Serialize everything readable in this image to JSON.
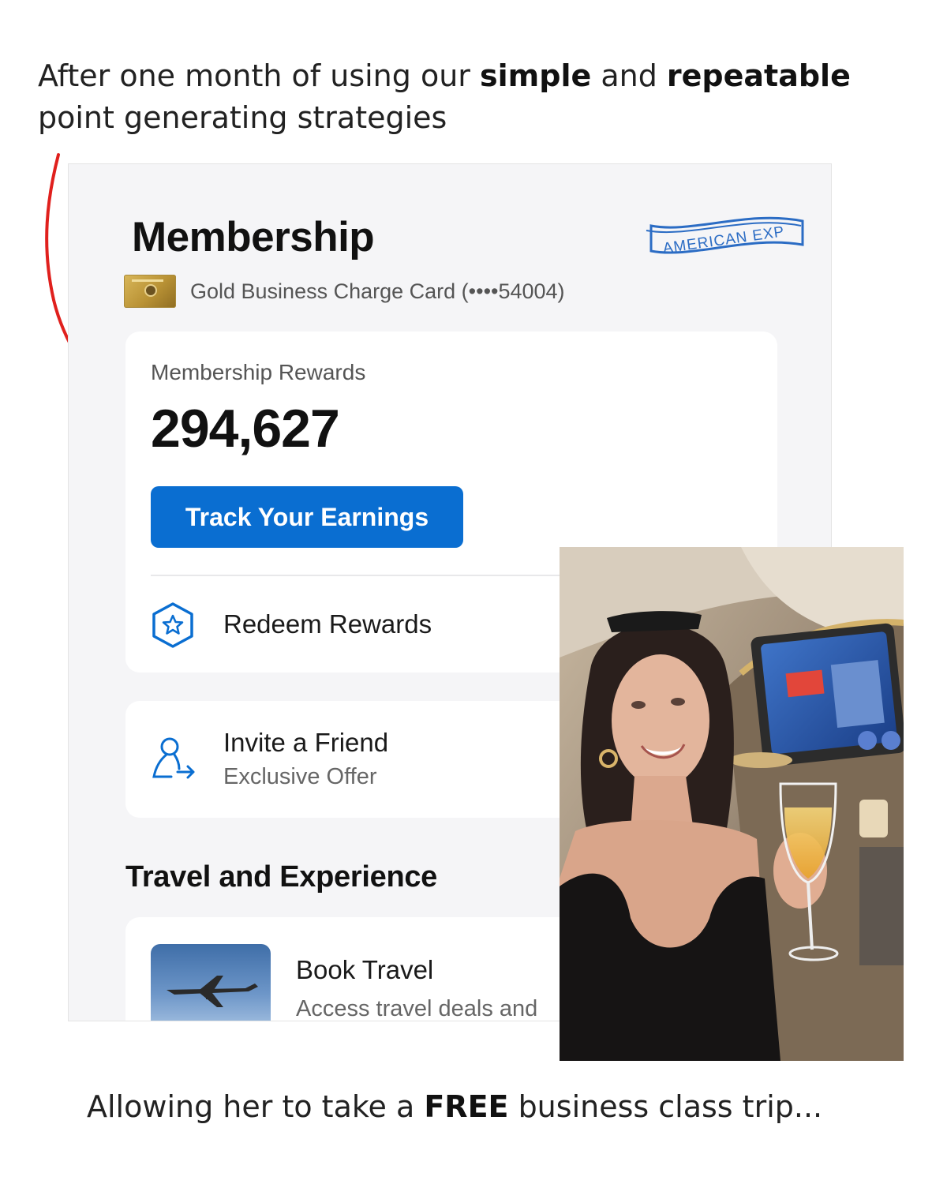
{
  "caption_top": {
    "part1": "After one month of using our ",
    "bold1": "simple",
    "part2": " and ",
    "bold2": "repeatable",
    "part3": " point generating strategies"
  },
  "app": {
    "title": "Membership",
    "logo_text": "AMERICAN EXP",
    "card_label": "Gold Business Charge Card (••••54004)",
    "rewards_label": "Membership Rewards",
    "rewards_points": "294,627",
    "track_button": "Track Your Earnings",
    "redeem_label": "Redeem Rewards",
    "invite_title": "Invite a Friend",
    "invite_subtitle": "Exclusive Offer",
    "section_title": "Travel and Experience",
    "travel_title": "Book Travel",
    "travel_subtitle": "Access travel deals and"
  },
  "caption_bottom": {
    "part1": "Allowing her to take a ",
    "bold": "FREE",
    "part2": " business class trip..."
  },
  "colors": {
    "accent_blue": "#0a6ed1",
    "amex_blue": "#2b6cc4",
    "arrow_red": "#e0201d"
  },
  "icons": {
    "redeem": "hexagon-star-icon",
    "invite": "person-arrow-icon",
    "arrow": "red-curved-arrow"
  }
}
